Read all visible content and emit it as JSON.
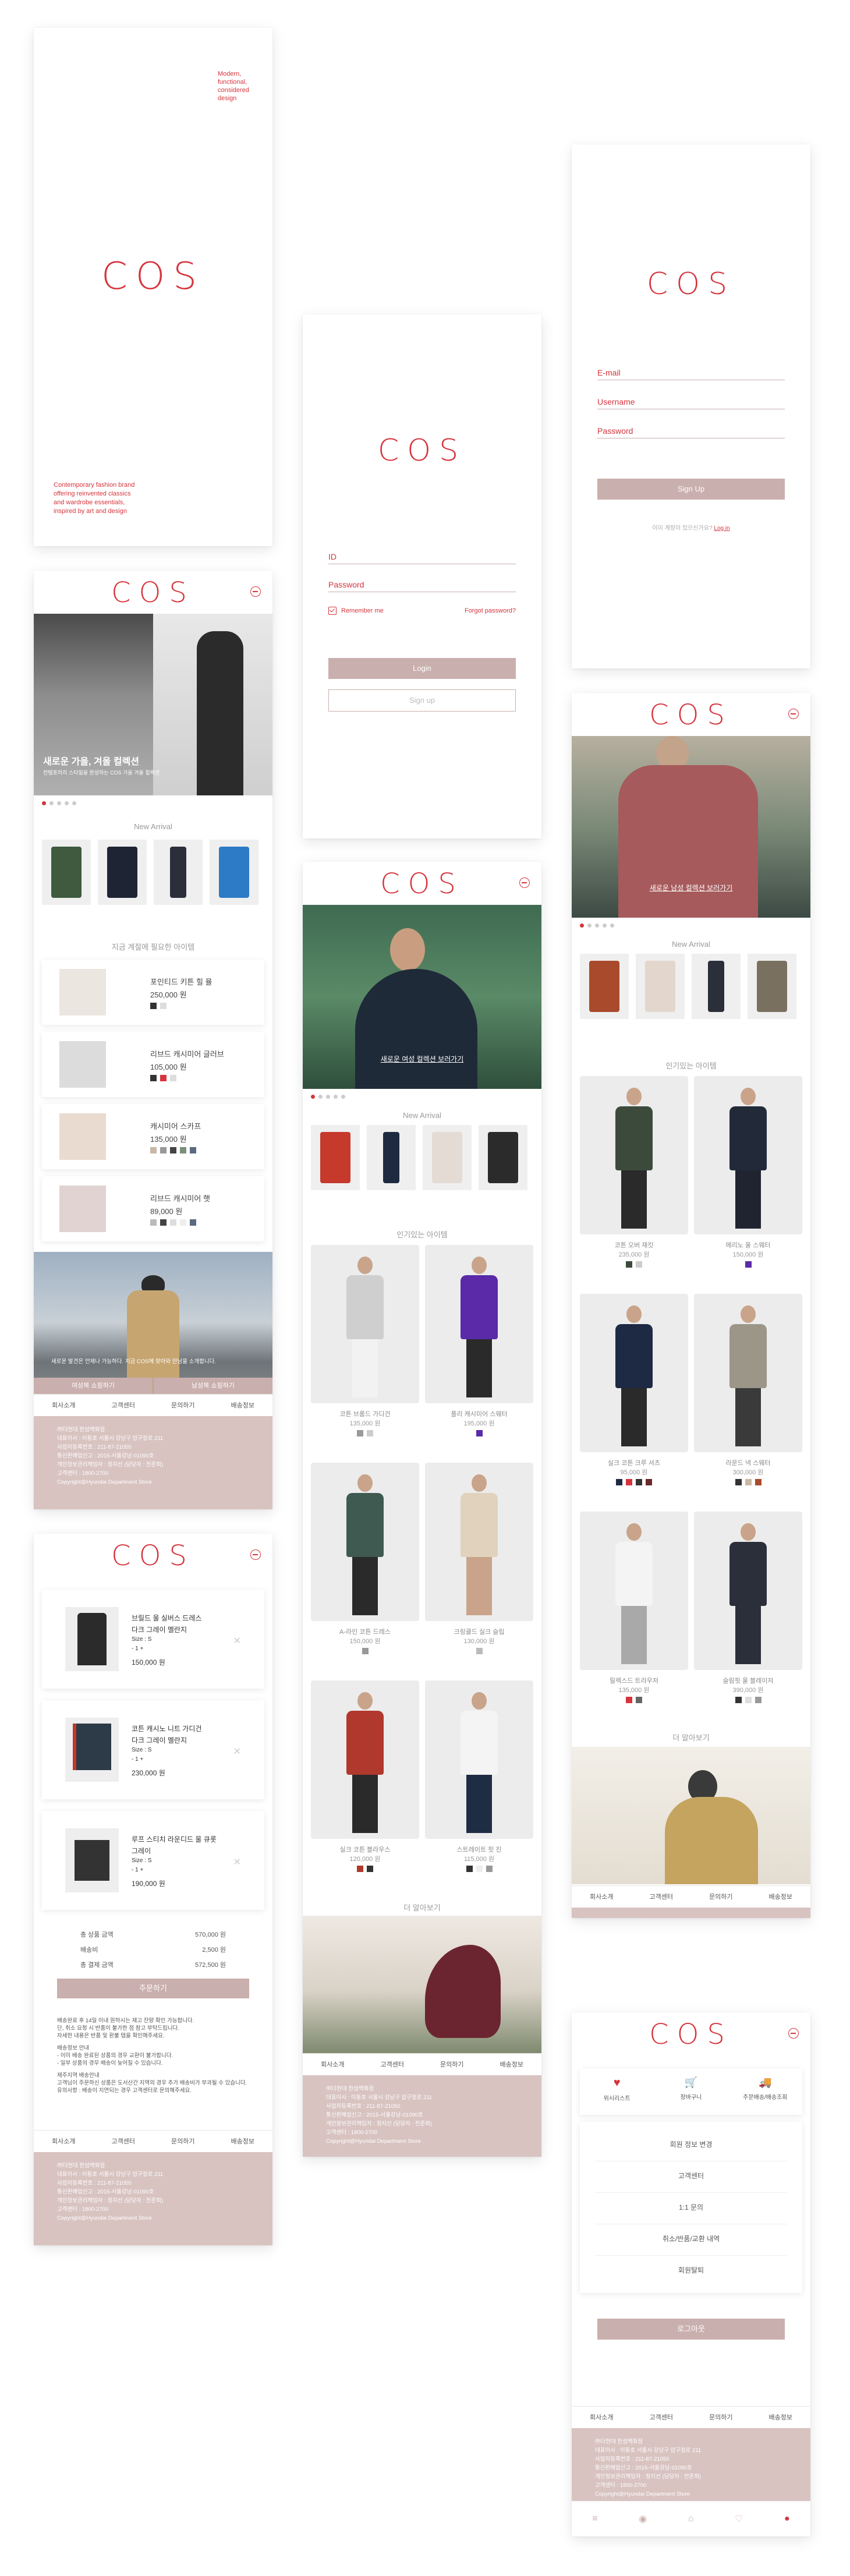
{
  "brand": {
    "logo": "COS",
    "accent": "#d6343c",
    "pink": "#c9afad",
    "footer_bg": "#d8c3c1"
  },
  "splash": {
    "tagline": "Modern,\nfunctional,\nconsidered\ndesign",
    "description": "Contemporary fashion brand\noffering reinvented classics\nand wardrobe essentials,\ninspired by art and design"
  },
  "login": {
    "id_label": "ID",
    "password_label": "Password",
    "remember": "Remember me",
    "forgot": "Forgot password?",
    "login_button": "Login",
    "signup_button": "Sign up"
  },
  "signup": {
    "email_label": "E-mail",
    "username_label": "Username",
    "password_label": "Password",
    "button": "Sign Up",
    "already": "이미 계정이 있으신가요?",
    "login_link": "Log in"
  },
  "home1": {
    "hero_title": "새로운 가을, 겨울 컬렉션",
    "hero_sub": "컨템포러리 스타일을 완성하는 COS 가을 겨울 컬렉션",
    "new_arrival": "New Arrival",
    "section2": "지금 계절에 필요한 아이템",
    "products": [
      {
        "name": "포인티드 키튼 힐 뮬",
        "price": "250,000 원"
      },
      {
        "name": "리브드 캐시미어 글러브",
        "price": "105,000 원"
      },
      {
        "name": "캐시미어 스카프",
        "price": "135,000 원"
      },
      {
        "name": "리브드 캐시미어 햇",
        "price": "89,000 원"
      }
    ],
    "banner_text": "새로운 발견은 언제나 가능하다. 지금 COS에 찾아와 만남을 소개합니다.",
    "btn_left": "여성복 쇼핑하기",
    "btn_right": "남성복 쇼핑하기"
  },
  "footer": {
    "links": [
      "회사소개",
      "고객센터",
      "문의하기",
      "배송정보"
    ],
    "lines": [
      "㈜더현대 한섬백화점",
      "대표이사 : 이동호 서울시 강남구 압구정로 211",
      "사업자등록번호 : 211-87-21050",
      "통신판매업신고 : 2015-서울강남-01090호",
      "개인정보관리책임자 : 정지선 (담당자 : 전준희)",
      "고객센터 : 1800-2700",
      "Copyright@Hyundai Department Store"
    ]
  },
  "home_women": {
    "hero_link": "새로운 여성 컬렉션 보러가기",
    "new_arrival": "New Arrival",
    "popular": "인기있는 아이템",
    "items": [
      {
        "name": "코튼 브롬드 가디건",
        "price": "135,000 원"
      },
      {
        "name": "플리 캐시미어 스웨터",
        "price": "195,000 원"
      },
      {
        "name": "A-라인 코튼 드레스",
        "price": "150,000 원"
      },
      {
        "name": "크링클드 실크 슬립",
        "price": "130,000 원"
      },
      {
        "name": "실크 코튼 블라우스",
        "price": "120,000 원"
      },
      {
        "name": "스트레이트 핏 진",
        "price": "115,000 원"
      }
    ],
    "more": "더 알아보기"
  },
  "home_men": {
    "hero_link": "새로운 남성 컬렉션 보러가기",
    "new_arrival": "New Arrival",
    "popular": "인기있는 아이템",
    "items": [
      {
        "name": "코튼 오버 재킷",
        "price": "235,000 원"
      },
      {
        "name": "메리노 울 스웨터",
        "price": "150,000 원"
      },
      {
        "name": "실크 코튼 크루 셔츠",
        "price": "95,000 원"
      },
      {
        "name": "라운드 넥 스웨터",
        "price": "300,000 원"
      },
      {
        "name": "릴렉스드 트라우저",
        "price": "135,000 원"
      },
      {
        "name": "슬림핏 울 블레이저",
        "price": "390,000 원"
      }
    ],
    "more": "더 알아보기"
  },
  "cart": {
    "items": [
      {
        "name": "브릴드 울 실버스 드레스",
        "color": "다크 그레이 멜란지",
        "size": "Size : S",
        "qty": "- 1 +",
        "price": "150,000 원"
      },
      {
        "name": "코튼 캐시노 니트 가디건",
        "color": "다크 그레이 멜란지",
        "size": "Size : S",
        "qty": "- 1 +",
        "price": "230,000 원"
      },
      {
        "name": "루프 스티치 라운디드 울 큐롯",
        "color": "그레이",
        "size": "Size : S",
        "qty": "- 1 +",
        "price": "190,000 원"
      }
    ],
    "subtotal_label": "총 상품 금액",
    "subtotal": "570,000 원",
    "shipping_label": "배송비",
    "shipping": "2,500 원",
    "total_label": "총 결제 금액",
    "total": "572,500 원",
    "order_button": "주문하기",
    "notes": [
      "배송완료 후 14일 이내 원하시는 재고 잔량 확인 가능합니다.",
      "단, 취소 요청 시 반품이 불가한 점 참고 부탁드립니다.",
      "자세한 내용은 반품 및 환불 탭을 확인해주세요.",
      "",
      "배송정보 안내",
      "- 이미 배송 완료된 상품의 경우 교환이 불가합니다.",
      "- 일부 상품의 경우 배송이 늦어질 수 있습니다.",
      "",
      "제주지역 배송안내",
      "고객님이 주문하신 상품은 도서산간 지역의 경우 추가 배송비가 부과될 수 있습니다.",
      "유의사항 : 배송이 지연되는 경우 고객센터로 문의해주세요."
    ]
  },
  "mypage": {
    "quick": [
      {
        "icon": "heart-icon",
        "label": "위시리스트"
      },
      {
        "icon": "cart-icon",
        "label": "장바구니"
      },
      {
        "icon": "truck-icon",
        "label": "주문배송/배송조회"
      }
    ],
    "menu": [
      "회원 정보 변경",
      "고객센터",
      "1:1 문의",
      "취소/반품/교환 내역",
      "회원탈퇴"
    ],
    "logout": "로그아웃"
  }
}
